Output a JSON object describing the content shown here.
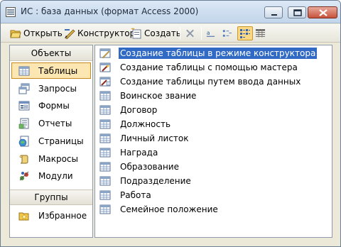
{
  "window": {
    "title": "ИС : база данных (формат Access 2000)"
  },
  "toolbar": {
    "open_label": "Открыть",
    "designer_label": "Конструктор",
    "create_label": "Создать"
  },
  "nav": {
    "objects_header": "Объекты",
    "items": [
      {
        "label": "Таблицы",
        "icon": "table-icon"
      },
      {
        "label": "Запросы",
        "icon": "query-icon"
      },
      {
        "label": "Формы",
        "icon": "form-icon"
      },
      {
        "label": "Отчеты",
        "icon": "report-icon"
      },
      {
        "label": "Страницы",
        "icon": "page-icon"
      },
      {
        "label": "Макросы",
        "icon": "macro-icon"
      },
      {
        "label": "Модули",
        "icon": "module-icon"
      }
    ],
    "groups_header": "Группы",
    "favorites_label": "Избранное"
  },
  "list": {
    "items": [
      "Создание таблицы в режиме конструктора",
      "Создание таблицы с помощью мастера",
      "Создание таблицы путем ввода данных",
      "Воинское звание",
      "Договор",
      "Должность",
      "Личный листок",
      "Награда",
      "Образование",
      "Подразделение",
      "Работа",
      "Семейное положение"
    ],
    "selected_index": 0
  },
  "colors": {
    "selection": "#316ac5",
    "nav_selected": "#fce7b3"
  }
}
